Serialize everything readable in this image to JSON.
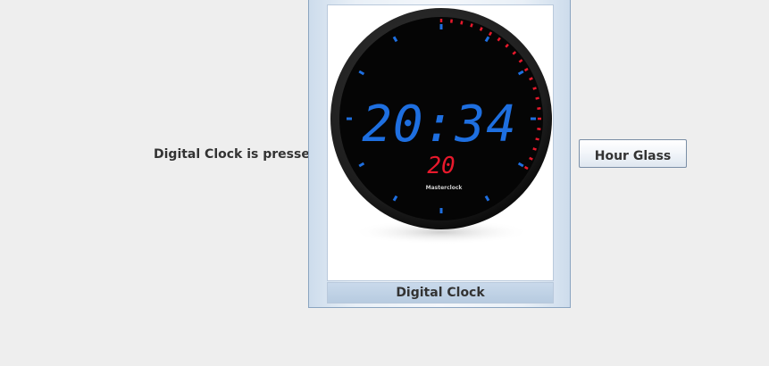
{
  "status": {
    "text": "Digital Clock is pressed"
  },
  "clock_button": {
    "caption": "Digital Clock",
    "image": {
      "subject": "round wall clock with LED digits",
      "time": "20:34",
      "seconds": "20",
      "brand": "Masterclock",
      "colors": {
        "time_digits": "#1e6fe0",
        "seconds_digits": "#e8192c",
        "face": "#050505",
        "bezel": "#2a2a2a"
      }
    }
  },
  "hour_glass_button": {
    "label": "Hour Glass"
  }
}
